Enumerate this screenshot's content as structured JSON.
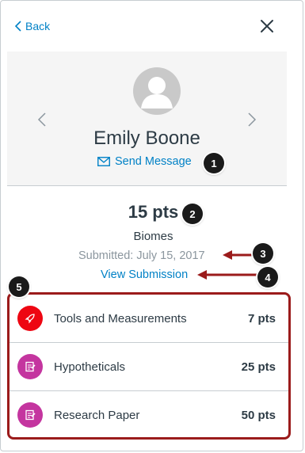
{
  "nav": {
    "back_label": "Back"
  },
  "student": {
    "name": "Emily Boone",
    "send_message_label": "Send Message"
  },
  "grade": {
    "score": "15 pts",
    "assignment": "Biomes",
    "submitted": "Submitted: July 15, 2017",
    "view_submission_label": "View Submission"
  },
  "rubric": {
    "items": [
      {
        "title": "Tools and Measurements",
        "points": "7 pts",
        "color": "#ee0612"
      },
      {
        "title": "Hypotheticals",
        "points": "25 pts",
        "color": "#c4359f"
      },
      {
        "title": "Research Paper",
        "points": "50 pts",
        "color": "#c4359f"
      }
    ]
  },
  "callouts": [
    "1",
    "2",
    "3",
    "4",
    "5"
  ],
  "colors": {
    "link": "#0081c6",
    "annotation": "#9b1b1b",
    "text": "#2d3b45",
    "muted": "#8b969e"
  }
}
